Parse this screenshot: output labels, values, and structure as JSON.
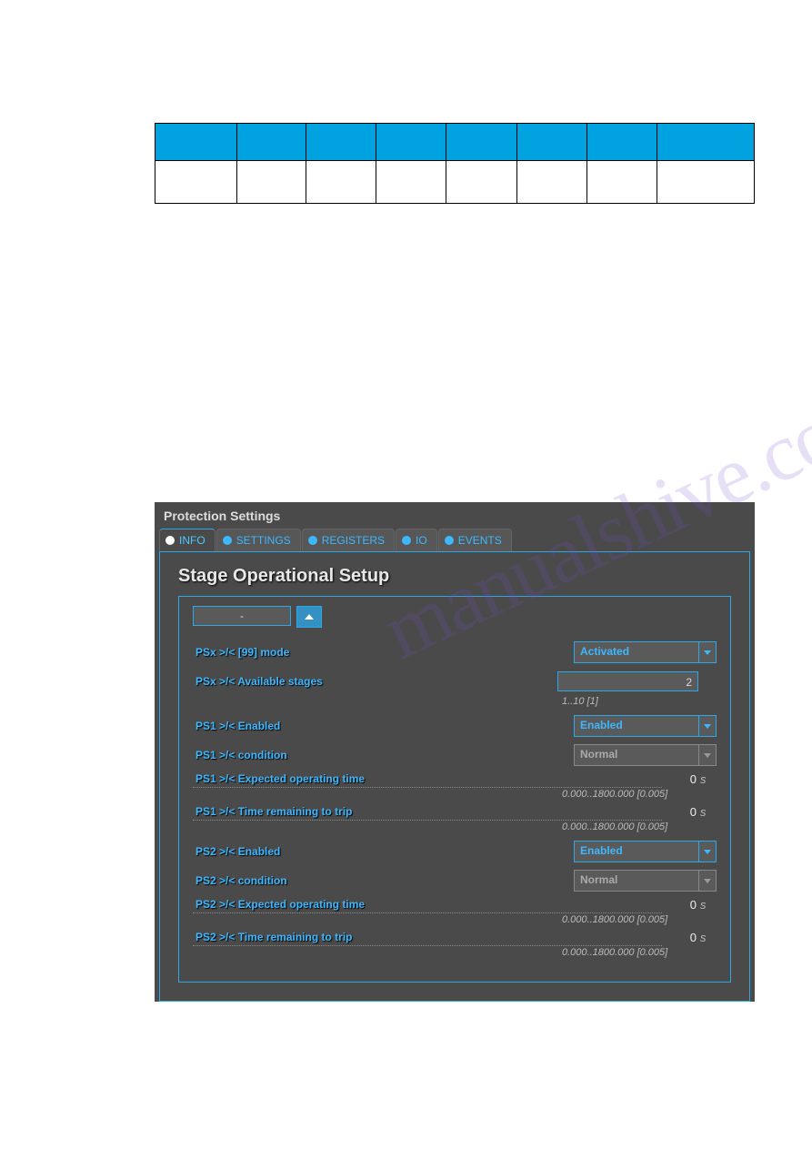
{
  "panel": {
    "title": "Protection Settings",
    "section_title": "Stage Operational Setup",
    "collapse_label": "-"
  },
  "tabs": [
    {
      "label": "INFO",
      "active": true
    },
    {
      "label": "SETTINGS",
      "active": false
    },
    {
      "label": "REGISTERS",
      "active": false
    },
    {
      "label": "IO",
      "active": false
    },
    {
      "label": "EVENTS",
      "active": false
    }
  ],
  "fields": {
    "mode": {
      "label": "PSx >/< [99] mode",
      "value": "Activated"
    },
    "stages": {
      "label": "PSx >/< Available stages",
      "value": "2",
      "hint": "1..10 [1]"
    },
    "ps1_enabled": {
      "label": "PS1 >/< Enabled",
      "value": "Enabled"
    },
    "ps1_condition": {
      "label": "PS1 >/< condition",
      "value": "Normal"
    },
    "ps1_exp": {
      "label": "PS1 >/< Expected operating time",
      "value": "0",
      "unit": "s",
      "hint": "0.000..1800.000 [0.005]"
    },
    "ps1_rem": {
      "label": "PS1 >/< Time remaining to trip",
      "value": "0",
      "unit": "s",
      "hint": "0.000..1800.000 [0.005]"
    },
    "ps2_enabled": {
      "label": "PS2 >/< Enabled",
      "value": "Enabled"
    },
    "ps2_condition": {
      "label": "PS2 >/< condition",
      "value": "Normal"
    },
    "ps2_exp": {
      "label": "PS2 >/< Expected operating time",
      "value": "0",
      "unit": "s",
      "hint": "0.000..1800.000 [0.005]"
    },
    "ps2_rem": {
      "label": "PS2 >/< Time remaining to trip",
      "value": "0",
      "unit": "s",
      "hint": "0.000..1800.000 [0.005]"
    }
  },
  "watermark": "manualshive.com"
}
